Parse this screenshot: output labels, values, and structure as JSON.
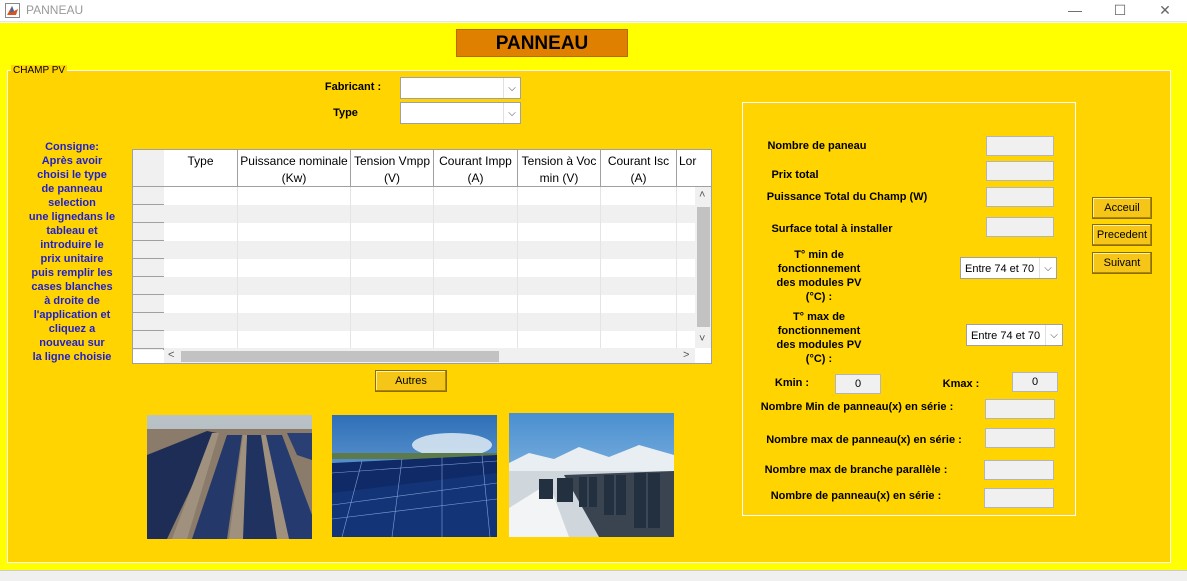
{
  "window": {
    "title": "PANNEAU",
    "minimize": "—",
    "maximize": "☐",
    "close": "✕"
  },
  "header": {
    "title": "PANNEAU"
  },
  "panel": {
    "title": "CHAMP PV"
  },
  "selectors": {
    "fabricant_label": "Fabricant :",
    "type_label": "Type",
    "fabricant_value": "",
    "type_value": ""
  },
  "consigne": {
    "lines": [
      "Consigne:",
      "Après avoir",
      "choisi le type",
      "de panneau",
      "selection",
      "une lignedans le",
      "tableau et",
      "introduire le",
      "prix unitaire",
      "puis remplir les",
      "cases blanches",
      "à droite de",
      "l'application et",
      "cliquez a",
      "nouveau sur",
      "la ligne choisie"
    ]
  },
  "table": {
    "columns": [
      {
        "l1": "Type",
        "l2": ""
      },
      {
        "l1": "Puissance nominale",
        "l2": "(Kw)"
      },
      {
        "l1": "Tension Vmpp",
        "l2": "(V)"
      },
      {
        "l1": "Courant  Impp",
        "l2": "(A)"
      },
      {
        "l1": "Tension à  Voc",
        "l2": "min (V)"
      },
      {
        "l1": "Courant Isc",
        "l2": "(A)"
      },
      {
        "l1": "Lor",
        "l2": ""
      }
    ],
    "scroll_up": "˄",
    "scroll_down": "˅",
    "scroll_left": "<",
    "scroll_right": ">"
  },
  "buttons": {
    "autres": "Autres",
    "acceuil": "Acceuil",
    "precedent": "Precedent",
    "suivant": "Suivant"
  },
  "right": {
    "nombre_panneau": "Nombre de paneau",
    "prix_total": "Prix total",
    "puissance_total": "Puissance Total du Champ (W)",
    "surface_total": "Surface total à installer",
    "tmin_label": [
      "T° min de",
      "fonctionnement",
      "des modules PV",
      "(°C) :"
    ],
    "tmin_value": "Entre 74 et 70",
    "tmax_label": [
      "T° max de",
      "fonctionnement",
      "des modules PV",
      "(°C) :"
    ],
    "tmax_value": "Entre 74 et 70",
    "kmin_label": "Kmin :",
    "kmin_value": "0",
    "kmax_label": "Kmax :",
    "kmax_value": "0",
    "nb_min_serie": "Nombre Min de panneau(x) en série :",
    "nb_max_serie": "Nombre max de panneau(x) en série :",
    "nb_max_branche": "Nombre max de branche parallèle :",
    "nb_serie": "Nombre  de panneau(x) en série :"
  },
  "colors": {
    "background": "#ffff00",
    "panel": "#ffd400",
    "title_bg": "#e08000",
    "consigne_text": "#1f1fcf"
  }
}
